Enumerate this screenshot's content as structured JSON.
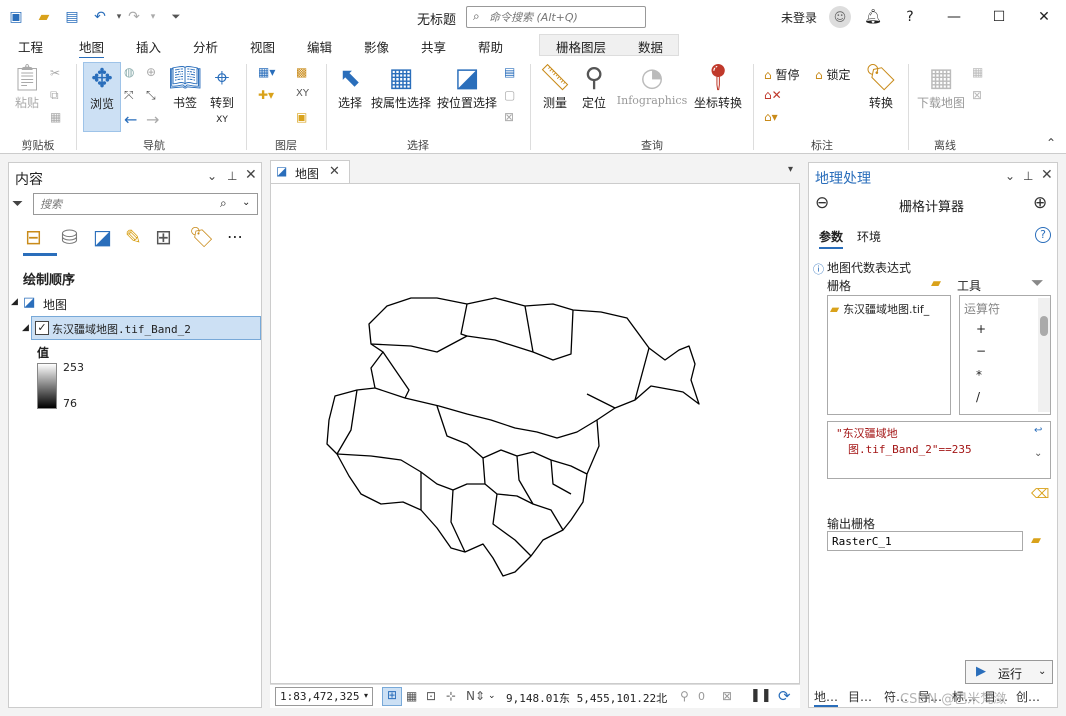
{
  "window": {
    "title": "无标题",
    "login": "未登录"
  },
  "command_search": {
    "placeholder": "命令搜索 (Alt+Q)"
  },
  "ribbon_tabs": [
    "工程",
    "地图",
    "插入",
    "分析",
    "视图",
    "编辑",
    "影像",
    "共享",
    "帮助"
  ],
  "context_tabs": [
    "栅格图层",
    "数据"
  ],
  "ribbon": {
    "clipboard": {
      "paste": "粘贴",
      "group": "剪贴板"
    },
    "navigate": {
      "explore": "浏览",
      "bookmarks": "书签",
      "goto": "转到",
      "goto_sub": "XY",
      "group": "导航"
    },
    "layer": {
      "group": "图层"
    },
    "selection": {
      "select": "选择",
      "by_attr": "按属性选择",
      "by_loc": "按位置选择",
      "group": "选择"
    },
    "inquiry": {
      "measure": "测量",
      "locate": "定位",
      "infographics": "Infographics",
      "convert_coord": "坐标转换",
      "group": "查询"
    },
    "labeling": {
      "pause": "暂停",
      "lock": "锁定",
      "convert": "转换",
      "group": "标注"
    },
    "offline": {
      "download": "下载地图",
      "group": "离线"
    }
  },
  "contents": {
    "title": "内容",
    "search_placeholder": "搜索",
    "draw_order": "绘制顺序",
    "map_name": "地图",
    "layer_name": "东汉疆域地图.tif_Band_2",
    "legend_label": "值",
    "legend_max": "253",
    "legend_min": "76"
  },
  "map_view": {
    "tab": "地图",
    "scale": "1:83,472,325",
    "coords": "9,148.01东 5,455,101.22北",
    "selected_count": "0"
  },
  "geoprocessing": {
    "title": "地理处理",
    "tool_title": "栅格计算器",
    "tab_params": "参数",
    "tab_env": "环境",
    "expr_label": "地图代数表达式",
    "rasters_label": "栅格",
    "tools_label": "工具",
    "raster_item": "东汉疆域地图.tif_",
    "operators_header": "运算符",
    "operators": [
      "+",
      "−",
      "*",
      "/"
    ],
    "expression_line1": "\"东汉疆域地",
    "expression_line2": "图.tif_Band_2\"==235",
    "output_label": "输出栅格",
    "output_value": "RasterC_1",
    "run": "运行"
  },
  "bottom_tabs": [
    "地…",
    "目…",
    "符…",
    "导…",
    "标…",
    "目…",
    "创…"
  ],
  "watermark": "CSDN @巴米梵潋",
  "colors": {
    "accent": "#2a6ebb",
    "selection": "#cce0f4"
  }
}
